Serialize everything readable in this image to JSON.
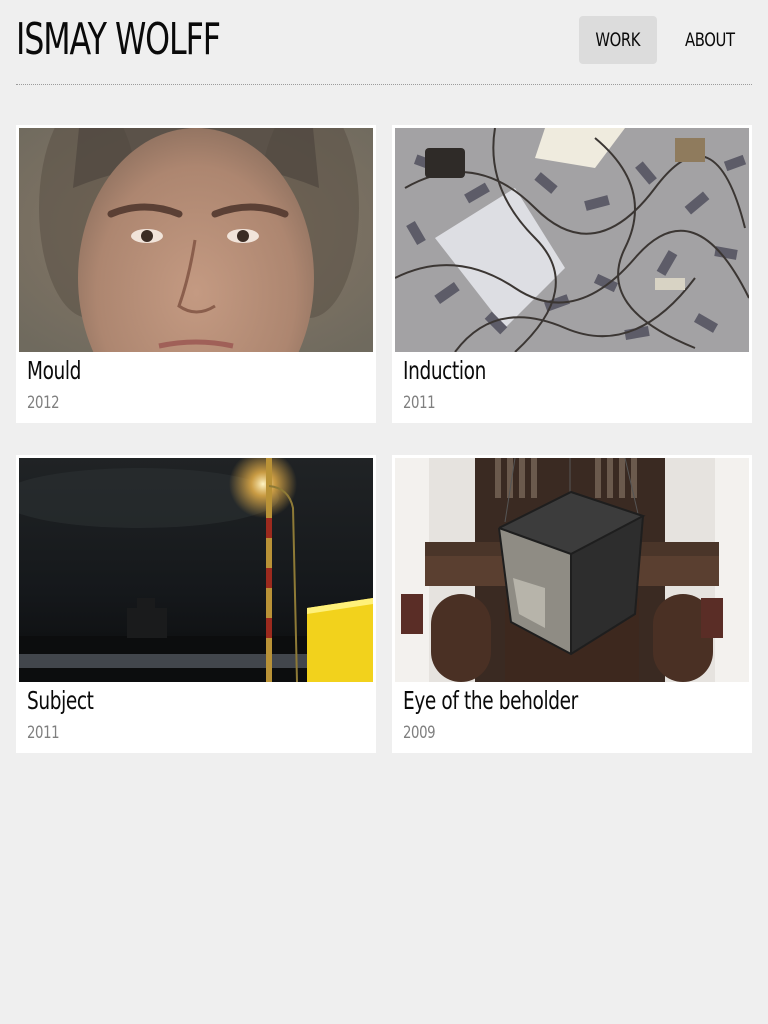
{
  "site": {
    "title": "ISMAY WOLFF"
  },
  "nav": {
    "items": [
      {
        "label": "WORK",
        "active": true
      },
      {
        "label": "ABOUT",
        "active": false
      }
    ],
    "active_bg": "#dcdcdc"
  },
  "works": [
    {
      "title": "Mould",
      "year": "2012",
      "thumbnail": "face-portrait"
    },
    {
      "title": "Induction",
      "year": "2011",
      "thumbnail": "cables-on-floor"
    },
    {
      "title": "Subject",
      "year": "2011",
      "thumbnail": "night-streetlight"
    },
    {
      "title": "Eye of the beholder",
      "year": "2009",
      "thumbnail": "cube-in-church"
    }
  ],
  "colors": {
    "background": "#efefef",
    "card": "#ffffff",
    "year_text": "#7f7f7f"
  }
}
